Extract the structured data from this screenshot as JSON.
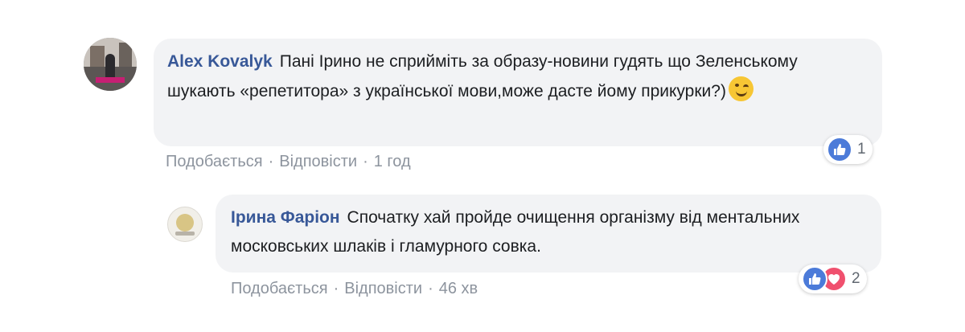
{
  "comment": {
    "author": "Alex Kovalyk",
    "text": "Пані Ірино не сприйміть за образу-новини гудять що Зеленському шукають «репетитора» з української мови,може дасте йому прикурки?)",
    "emoji": "wink-emoji",
    "actions": {
      "like": "Подобається",
      "reply": "Відповісти",
      "separator": "·",
      "time": "1 год"
    },
    "reactions": {
      "icons": [
        "like-icon"
      ],
      "count": "1",
      "like_color": "#4c7bd9"
    }
  },
  "reply": {
    "author": "Ірина Фаріон",
    "text": "Спочатку хай пройде очищення організму від ментальних московських шлаків і гламурного совка.",
    "actions": {
      "like": "Подобається",
      "reply": "Відповісти",
      "separator": "·",
      "time": "46 хв"
    },
    "reactions": {
      "icons": [
        "like-icon",
        "love-icon"
      ],
      "count": "2",
      "like_color": "#4c7bd9",
      "love_color": "#f0506e"
    }
  },
  "colors": {
    "author_link": "#385898",
    "bubble": "#f2f3f5",
    "meta_text": "#90949c"
  }
}
